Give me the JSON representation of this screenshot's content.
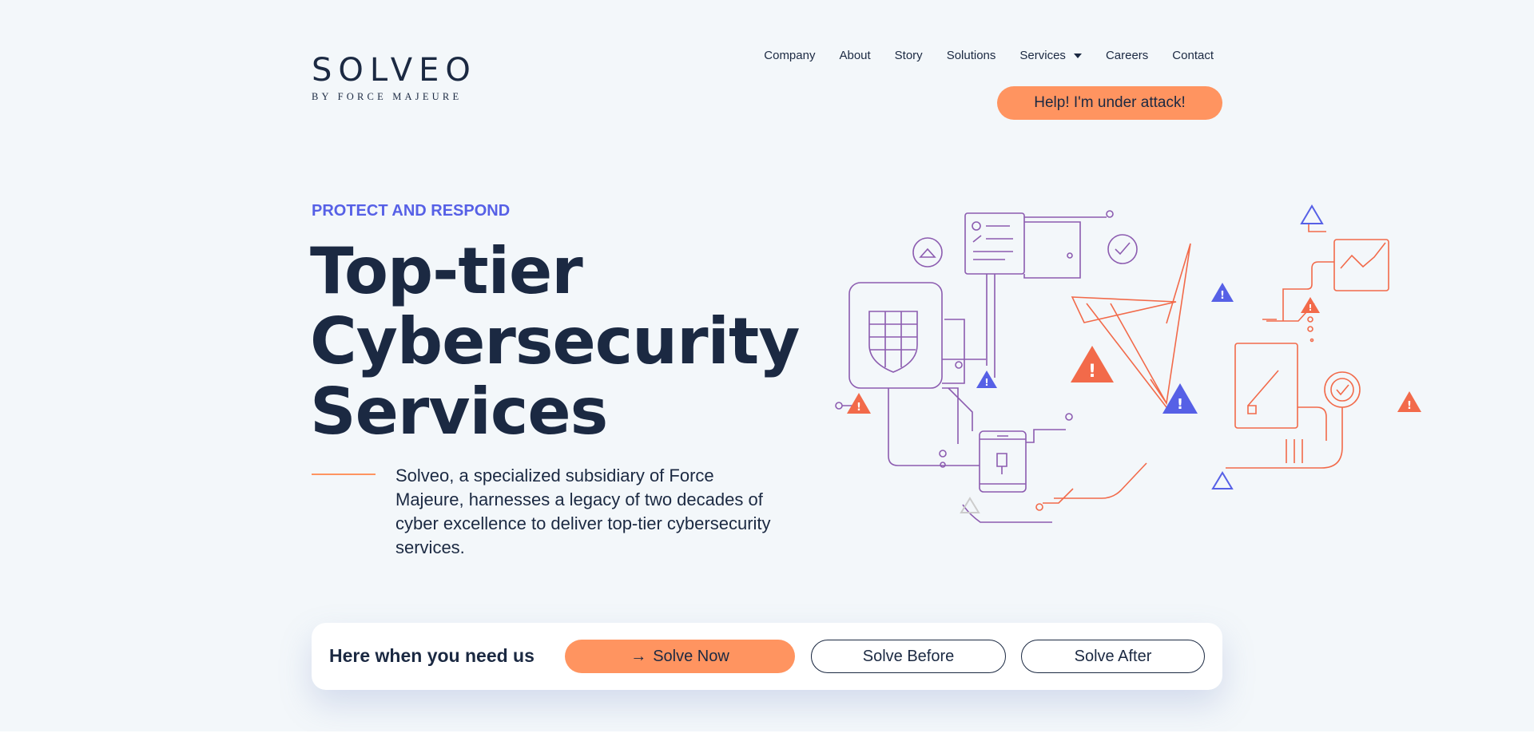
{
  "brand": {
    "name": "SOLVEO",
    "tagline": "BY FORCE MAJEURE"
  },
  "nav": {
    "items": [
      {
        "label": "Company"
      },
      {
        "label": "About"
      },
      {
        "label": "Story"
      },
      {
        "label": "Solutions"
      },
      {
        "label": "Services"
      },
      {
        "label": "Careers"
      },
      {
        "label": "Contact"
      }
    ],
    "attack_button": "Help! I'm under attack!"
  },
  "hero": {
    "eyebrow": "PROTECT AND RESPOND",
    "title_lines": [
      "Top-tier",
      "Cybersecurity",
      "Services"
    ],
    "description": "Solveo, a specialized subsidiary of Force Majeure, harnesses a legacy of two decades of cyber excellence to deliver top-tier cybersecurity services."
  },
  "cta": {
    "label": "Here when you need us",
    "primary": "Solve Now",
    "primary_icon": "arrow-right-icon",
    "before": "Solve Before",
    "after": "Solve After"
  },
  "colors": {
    "accent_orange": "#ff9460",
    "accent_blue": "#5660e6",
    "purple_line": "#8c5cb0",
    "text_dark": "#1b2942",
    "background": "#f3f7fa"
  }
}
